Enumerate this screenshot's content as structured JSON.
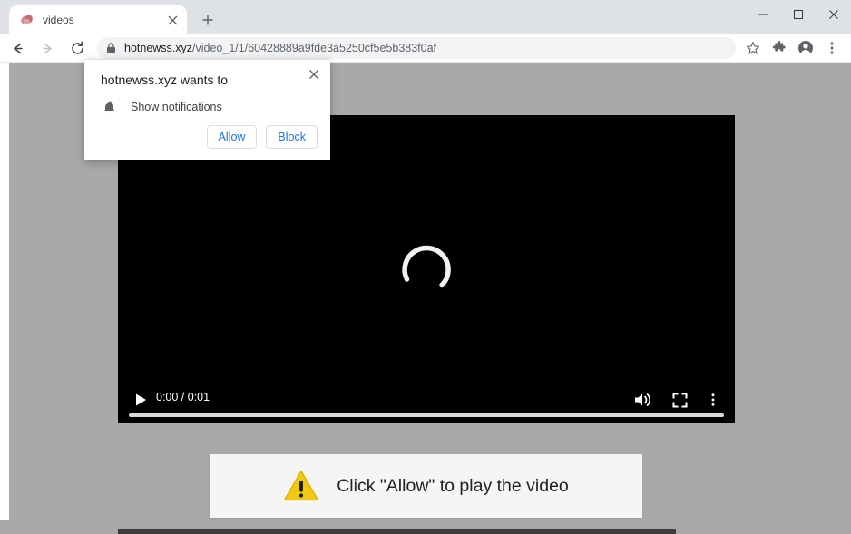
{
  "browser": {
    "tab": {
      "title": "videos",
      "favicon": "site-favicon",
      "close_icon": "close-icon",
      "new_tab_icon": "plus-icon"
    },
    "window_controls": {
      "minimize": "minimize-icon",
      "maximize": "maximize-icon",
      "close": "close-icon"
    },
    "toolbar": {
      "back_icon": "back-arrow-icon",
      "forward_icon": "forward-arrow-icon",
      "reload_icon": "reload-icon",
      "lock_icon": "lock-icon",
      "url_domain": "hotnewss.xyz",
      "url_path": "/video_1/1/60428889a9fde3a5250cf5e5b383f0af",
      "url_full": "hotnewss.xyz/video_1/1/60428889a9fde3a5250cf5e5b383f0af",
      "bookmark_icon": "star-icon",
      "extensions_icon": "puzzle-icon",
      "profile_icon": "account-avatar-icon",
      "menu_icon": "three-dot-menu-icon"
    }
  },
  "dialog": {
    "title": "hotnewss.xyz wants to",
    "permission_icon": "bell-icon",
    "permission_label": "Show notifications",
    "allow_label": "Allow",
    "block_label": "Block",
    "close_icon": "close-icon",
    "accent_color": "#1a73e8"
  },
  "video": {
    "state_icon": "loading-spinner-icon",
    "play_icon": "play-icon",
    "time_display": "0:00 / 0:01",
    "current_time": "0:00",
    "duration": "0:01",
    "volume_icon": "volume-on-icon",
    "fullscreen_icon": "fullscreen-icon",
    "more_icon": "three-dot-menu-icon",
    "progress_percent": 0
  },
  "banner": {
    "icon": "warning-triangle-icon",
    "text": "Click \"Allow\" to play the video",
    "icon_color": "#f2c811",
    "background_color": "#f5f5f5"
  },
  "page": {
    "background_color": "#a9a9a9",
    "scrollbar": "horizontal-scrollbar"
  }
}
